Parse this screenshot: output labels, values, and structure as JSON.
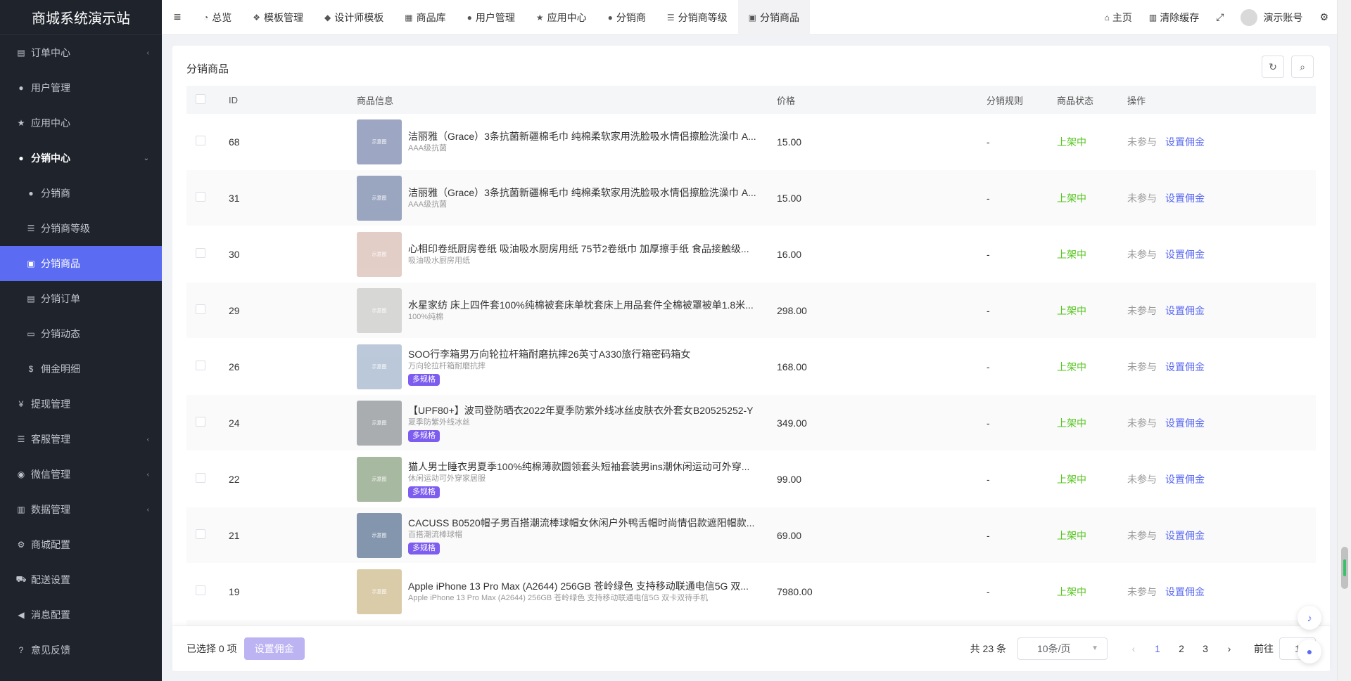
{
  "app": {
    "title": "商城系统演示站"
  },
  "sidebar": {
    "items": [
      {
        "icon": "file-icon",
        "glyph": "▤",
        "label": "订单中心",
        "arrow": "‹"
      },
      {
        "icon": "user-icon",
        "glyph": "●",
        "label": "用户管理",
        "arrow": ""
      },
      {
        "icon": "star-icon",
        "glyph": "★",
        "label": "应用中心",
        "arrow": ""
      },
      {
        "icon": "users-icon",
        "glyph": "●",
        "label": "分销中心",
        "arrow": "⌄"
      },
      {
        "icon": "user-icon",
        "glyph": "●",
        "label": "分销商",
        "arrow": ""
      },
      {
        "icon": "list-icon",
        "glyph": "☰",
        "label": "分销商等级",
        "arrow": ""
      },
      {
        "icon": "briefcase-icon",
        "glyph": "▣",
        "label": "分销商品",
        "arrow": ""
      },
      {
        "icon": "file-icon",
        "glyph": "▤",
        "label": "分销订单",
        "arrow": ""
      },
      {
        "icon": "id-card-icon",
        "glyph": "▭",
        "label": "分销动态",
        "arrow": ""
      },
      {
        "icon": "dollar-icon",
        "glyph": "$",
        "label": "佣金明细",
        "arrow": ""
      },
      {
        "icon": "yen-icon",
        "glyph": "¥",
        "label": "提现管理",
        "arrow": ""
      },
      {
        "icon": "list-icon",
        "glyph": "☰",
        "label": "客服管理",
        "arrow": "‹"
      },
      {
        "icon": "wechat-icon",
        "glyph": "◉",
        "label": "微信管理",
        "arrow": "‹"
      },
      {
        "icon": "bar-chart-icon",
        "glyph": "▥",
        "label": "数据管理",
        "arrow": "‹"
      },
      {
        "icon": "gears-icon",
        "glyph": "⚙",
        "label": "商城配置",
        "arrow": ""
      },
      {
        "icon": "car-icon",
        "glyph": "⛟",
        "label": "配送设置",
        "arrow": ""
      },
      {
        "icon": "bullhorn-icon",
        "glyph": "◀",
        "label": "消息配置",
        "arrow": ""
      },
      {
        "icon": "question-icon",
        "glyph": "?",
        "label": "意见反馈",
        "arrow": ""
      }
    ]
  },
  "topbar": {
    "menu_glyph": "≡",
    "tabs": [
      {
        "icon": "dashboard-icon",
        "glyph": "◔",
        "label": "总览"
      },
      {
        "icon": "cubes-icon",
        "glyph": "❖",
        "label": "模板管理"
      },
      {
        "icon": "cube-icon",
        "glyph": "◆",
        "label": "设计师模板"
      },
      {
        "icon": "shop-icon",
        "glyph": "▦",
        "label": "商品库"
      },
      {
        "icon": "user-icon",
        "glyph": "●",
        "label": "用户管理"
      },
      {
        "icon": "star-icon",
        "glyph": "★",
        "label": "应用中心"
      },
      {
        "icon": "user-icon",
        "glyph": "●",
        "label": "分销商"
      },
      {
        "icon": "list-icon",
        "glyph": "☰",
        "label": "分销商等级"
      },
      {
        "icon": "briefcase-icon",
        "glyph": "▣",
        "label": "分销商品"
      }
    ],
    "home": {
      "glyph": "⌂",
      "label": "主页"
    },
    "clear_cache": {
      "glyph": "▥",
      "label": "清除缓存"
    },
    "fullscreen_glyph": "⤢",
    "account": "演示账号",
    "settings_glyph": "⚙"
  },
  "card": {
    "title": "分销商品",
    "refresh_glyph": "↻",
    "search_glyph": "⌕"
  },
  "table": {
    "headers": {
      "id": "ID",
      "info": "商品信息",
      "price": "价格",
      "rule": "分销规则",
      "status": "商品状态",
      "op": "操作"
    },
    "image_label": "示意图",
    "rows": [
      {
        "id": "68",
        "name": "洁丽雅（Grace）3条抗菌新疆棉毛巾 纯棉柔软家用洗脸吸水情侣擦脸洗澡巾 A...",
        "sub": "AAA级抗菌",
        "tag": "",
        "price": "15.00",
        "rule": "-",
        "status": "上架中",
        "op1": "未参与",
        "op2": "设置佣金",
        "color": "#98a3c0"
      },
      {
        "id": "31",
        "name": "洁丽雅（Grace）3条抗菌新疆棉毛巾 纯棉柔软家用洗脸吸水情侣擦脸洗澡巾 A...",
        "sub": "AAA级抗菌",
        "tag": "",
        "price": "15.00",
        "rule": "-",
        "status": "上架中",
        "op1": "未参与",
        "op2": "设置佣金",
        "color": "#95a1bd"
      },
      {
        "id": "30",
        "name": "心相印卷纸厨房卷纸 吸油吸水厨房用纸 75节2卷纸巾 加厚擦手纸 食品接触级...",
        "sub": "吸油吸水厨房用纸",
        "tag": "",
        "price": "16.00",
        "rule": "-",
        "status": "上架中",
        "op1": "未参与",
        "op2": "设置佣金",
        "color": "#e2cbc5"
      },
      {
        "id": "29",
        "name": "水星家纺 床上四件套100%纯棉被套床单枕套床上用品套件全棉被罩被单1.8米...",
        "sub": "100%纯棉",
        "tag": "",
        "price": "298.00",
        "rule": "-",
        "status": "上架中",
        "op1": "未参与",
        "op2": "设置佣金",
        "color": "#d6d6d4"
      },
      {
        "id": "26",
        "name": "SOO行李箱男万向轮拉杆箱耐磨抗摔26英寸A330旅行箱密码箱女",
        "sub": "万向轮拉杆箱耐磨抗摔",
        "tag": "多规格",
        "price": "168.00",
        "rule": "-",
        "status": "上架中",
        "op1": "未参与",
        "op2": "设置佣金",
        "color": "#b8c6d8"
      },
      {
        "id": "24",
        "name": "【UPF80+】波司登防晒衣2022年夏季防紫外线冰丝皮肤衣外套女B20525252-Y",
        "sub": "夏季防紫外线冰丝",
        "tag": "多规格",
        "price": "349.00",
        "rule": "-",
        "status": "上架中",
        "op1": "未参与",
        "op2": "设置佣金",
        "color": "#a6a9ad"
      },
      {
        "id": "22",
        "name": "猫人男士睡衣男夏季100%纯棉薄款圆领套头短袖套装男ins潮休闲运动可外穿...",
        "sub": "休闲运动可外穿家居服",
        "tag": "多规格",
        "price": "99.00",
        "rule": "-",
        "status": "上架中",
        "op1": "未参与",
        "op2": "设置佣金",
        "color": "#a4b69c"
      },
      {
        "id": "21",
        "name": "CACUSS B0520帽子男百搭潮流棒球帽女休闲户外鸭舌帽时尚情侣款遮阳帽款...",
        "sub": "百搭潮流棒球帽",
        "tag": "多规格",
        "price": "69.00",
        "rule": "-",
        "status": "上架中",
        "op1": "未参与",
        "op2": "设置佣金",
        "color": "#7d91aa"
      },
      {
        "id": "19",
        "name": "Apple iPhone 13 Pro Max (A2644) 256GB 苍岭绿色 支持移动联通电信5G 双...",
        "sub": "Apple iPhone 13 Pro Max (A2644) 256GB 苍岭绿色 支持移动联通电信5G 双卡双待手机",
        "tag": "",
        "price": "7980.00",
        "rule": "-",
        "status": "上架中",
        "op1": "未参与",
        "op2": "设置佣金",
        "color": "#d9c9a5"
      }
    ]
  },
  "footer": {
    "selected": "已选择 0 项",
    "set_commission": "设置佣金",
    "total": "共 23 条",
    "page_size": "10条/页",
    "prev_glyph": "‹",
    "next_glyph": "›",
    "pages": [
      "1",
      "2",
      "3"
    ],
    "goto_label": "前往",
    "goto_value": "1"
  }
}
